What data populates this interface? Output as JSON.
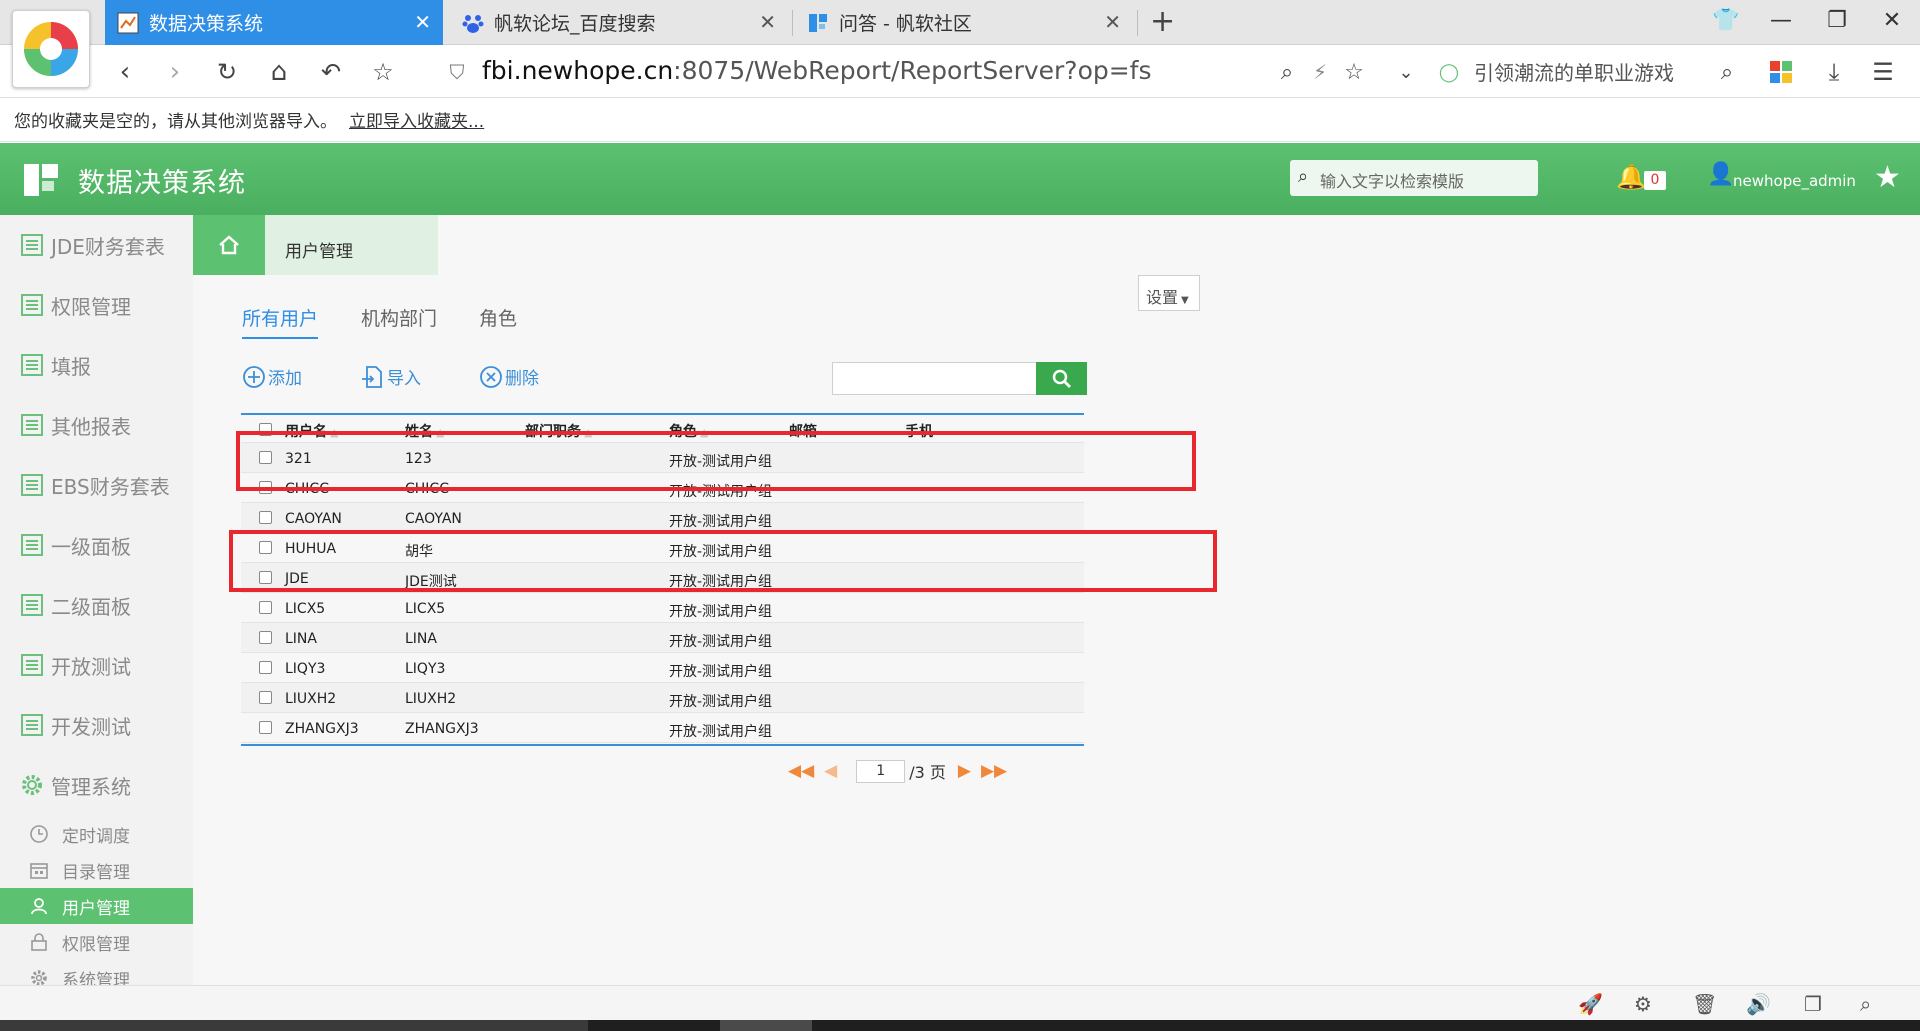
{
  "browser": {
    "tabs": [
      {
        "title": "数据决策系统",
        "active": true
      },
      {
        "title": "帆软论坛_百度搜索",
        "active": false
      },
      {
        "title": "问答 - 帆软社区",
        "active": false
      }
    ],
    "new_tab": "+",
    "url_host": "fbi.newhope.cn",
    "url_rest": ":8075/WebReport/ReportServer?op=fs",
    "search_engine_text": "引领潮流的单职业游戏",
    "bookmark_bar_text": "您的收藏夹是空的，请从其他浏览器导入。",
    "bookmark_bar_link": "立即导入收藏夹..."
  },
  "app": {
    "title": "数据决策系统",
    "search_placeholder": "输入文字以检索模版",
    "notification_count": "0",
    "username": "newhope_admin",
    "accent_color": "#5cc170"
  },
  "sidebar": {
    "items": [
      {
        "label": "JDE财务套表",
        "icon": "report-icon"
      },
      {
        "label": "权限管理",
        "icon": "report-icon"
      },
      {
        "label": "填报",
        "icon": "report-icon"
      },
      {
        "label": "其他报表",
        "icon": "report-icon"
      },
      {
        "label": "EBS财务套表",
        "icon": "report-icon"
      },
      {
        "label": "一级面板",
        "icon": "report-icon"
      },
      {
        "label": "二级面板",
        "icon": "report-icon"
      },
      {
        "label": "开放测试",
        "icon": "report-icon"
      },
      {
        "label": "开发测试",
        "icon": "report-icon"
      },
      {
        "label": "管理系统",
        "icon": "gear-icon"
      }
    ],
    "sub_items": [
      {
        "label": "定时调度",
        "icon": "clock-icon",
        "active": false
      },
      {
        "label": "目录管理",
        "icon": "calendar-icon",
        "active": false
      },
      {
        "label": "用户管理",
        "icon": "user-icon",
        "active": true
      },
      {
        "label": "权限管理",
        "icon": "lock-icon",
        "active": false
      },
      {
        "label": "系统管理",
        "icon": "gear-icon",
        "active": false
      }
    ]
  },
  "content": {
    "breadcrumb_tab": "用户管理",
    "settings_label": "设置",
    "sub_tabs": [
      "所有用户",
      "机构部门",
      "角色"
    ],
    "actions": {
      "add": "添加",
      "import": "导入",
      "delete": "删除"
    },
    "table": {
      "headers": [
        "用户名",
        "姓名",
        "部门职务",
        "角色",
        "邮箱",
        "手机"
      ],
      "rows": [
        {
          "username": "321",
          "name": "123",
          "role": "开放-测试用户组"
        },
        {
          "username": "CHICC",
          "name": "CHICC",
          "role": "开放-测试用户组"
        },
        {
          "username": "CAOYAN",
          "name": "CAOYAN",
          "role": "开放-测试用户组"
        },
        {
          "username": "HUHUA",
          "name": "胡华",
          "role": "开放-测试用户组"
        },
        {
          "username": "JDE",
          "name": "JDE测试",
          "role": "开放-测试用户组"
        },
        {
          "username": "LICX5",
          "name": "LICX5",
          "role": "开放-测试用户组"
        },
        {
          "username": "LINA",
          "name": "LINA",
          "role": "开放-测试用户组"
        },
        {
          "username": "LIQY3",
          "name": "LIQY3",
          "role": "开放-测试用户组"
        },
        {
          "username": "LIUXH2",
          "name": "LIUXH2",
          "role": "开放-测试用户组"
        },
        {
          "username": "ZHANGXJ3",
          "name": "ZHANGXJ3",
          "role": "开放-测试用户组"
        }
      ]
    },
    "pager": {
      "current_page": "1",
      "total_label": "/3 页"
    }
  }
}
